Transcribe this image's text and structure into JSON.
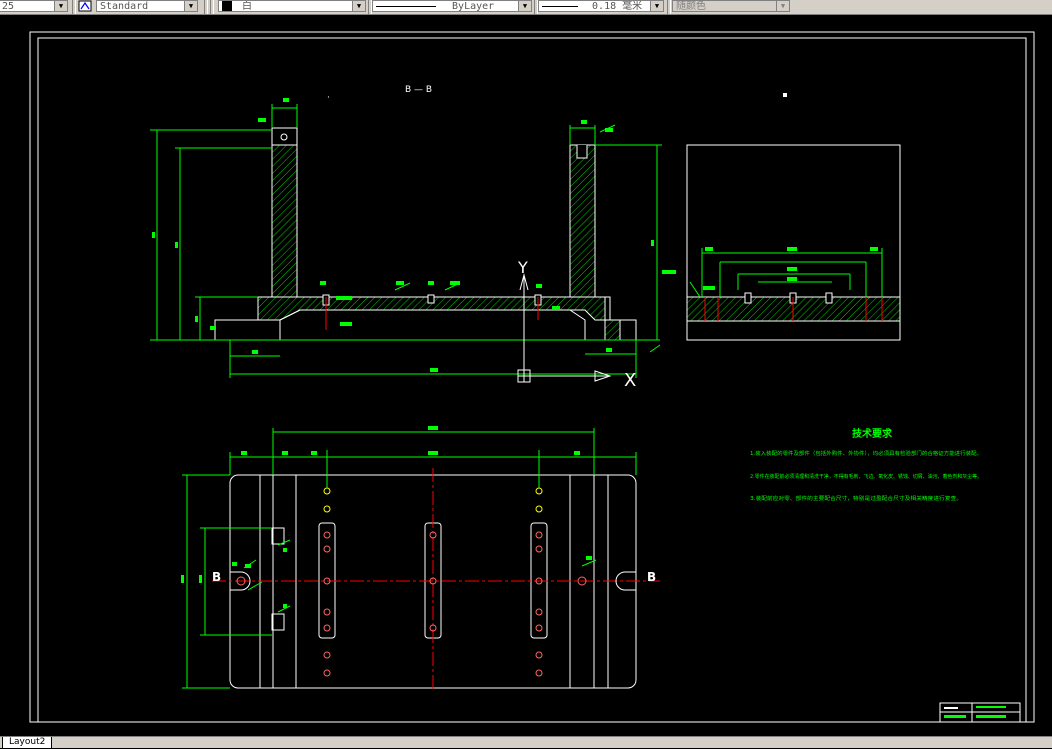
{
  "toolbar": {
    "scale_value": "25",
    "textstyle_value": "Standard",
    "layer_value": "白",
    "linetype_value": "ByLayer",
    "lineweight_value": "0.18 毫米",
    "plotstyle_value": "随颜色"
  },
  "drawing": {
    "section_label": "B — B",
    "tech_title": "技术要求",
    "tech_lines": [
      "1.装入装配的零件及部件（包括外购件、外协件），均必须具有检验部门的合格证方能进行装配。",
      "2.零件在装配前必须清理和清洗干净，不得有毛刺、飞边、氧化皮、锈蚀、切屑、油污、着色剂和灰尘等。",
      "3.装配前应对零、部件的主要配合尺寸，特别是过盈配合尺寸及相关精度进行复查。"
    ],
    "axis_y": "Y",
    "axis_x": "X",
    "section_mark_left": "B",
    "section_mark_right": "B"
  },
  "layout_tabs": [
    {
      "label": "Layout2"
    }
  ],
  "colors": {
    "background": "#000000",
    "outline": "#ffffff",
    "dimension": "#00ff00",
    "centerline": "#ff0000",
    "hatch": "#00ff00",
    "holes": "#ffff00"
  }
}
